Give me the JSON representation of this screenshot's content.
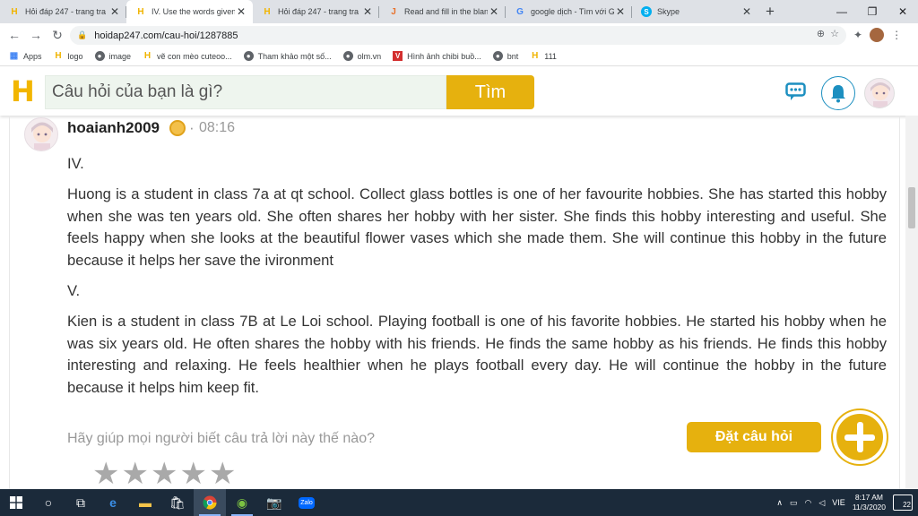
{
  "browser": {
    "tabs": [
      {
        "title": "Hỏi đáp 247 - trang tra",
        "icon": "h-logo-icon",
        "active": false
      },
      {
        "title": "IV. Use the words given",
        "icon": "h-logo-icon",
        "active": true
      },
      {
        "title": "Hỏi đáp 247 - trang tra",
        "icon": "h-logo-icon",
        "active": false
      },
      {
        "title": "Read and fill in the blan",
        "icon": "j-logo-icon",
        "active": false
      },
      {
        "title": "google dịch - Tìm với G",
        "icon": "google-icon",
        "active": false
      },
      {
        "title": "Skype",
        "icon": "skype-icon",
        "active": false
      }
    ],
    "url": "hoidap247.com/cau-hoi/1287885",
    "bookmarks": [
      {
        "label": "Apps",
        "icon": "apps-icon"
      },
      {
        "label": "logo",
        "icon": "h-logo-icon"
      },
      {
        "label": "image",
        "icon": "globe-icon"
      },
      {
        "label": "vẽ con mèo cuteoo...",
        "icon": "h-logo-icon"
      },
      {
        "label": "Tham khảo một số...",
        "icon": "globe-icon"
      },
      {
        "label": "olm.vn",
        "icon": "globe-icon"
      },
      {
        "label": "Hình ảnh chibi buồ...",
        "icon": "v-logo-icon"
      },
      {
        "label": "bnt",
        "icon": "globe-icon"
      },
      {
        "label": "111",
        "icon": "h-logo-icon"
      }
    ]
  },
  "site": {
    "search_placeholder": "Câu hỏi của bạn là gì?",
    "search_button": "Tìm"
  },
  "answer": {
    "username": "hoaianh2009",
    "separator": "·",
    "time": "08:16",
    "label_iv": "IV.",
    "para_iv": "Huong is a student in class 7a at qt school. Collect glass bottles is one of her favourite hobbies. She has started this hobby when she was ten years old. She often shares her hobby with her sister. She finds this hobby interesting and useful. She feels happy when she looks at the beautiful flower vases which she made them. She will continue this hobby in the future because it helps her save the ivironment",
    "label_v": "V.",
    "para_v": "Kien is a student in class 7B at Le Loi school. Playing football is one of his favorite hobbies.  He started his hobby when he was six years old. He often shares the hobby with his friends.  He finds the same hobby as his friends. He finds this hobby interesting and relaxing. He feels healthier when he plays football every day. He will continue the hobby in the future because it helps him keep fit.",
    "help_text": "Hãy giúp mọi người biết câu trả lời này thế nào?",
    "rating": 0,
    "rating_max": 5
  },
  "ask_button": "Đặt câu hỏi",
  "taskbar": {
    "language": "VIE",
    "time": "8:17 AM",
    "date": "11/3/2020",
    "notifications": "22"
  },
  "colors": {
    "accent": "#e6b10e",
    "brand_blue": "#1c8fc0",
    "taskbar": "#1b2a3a"
  }
}
